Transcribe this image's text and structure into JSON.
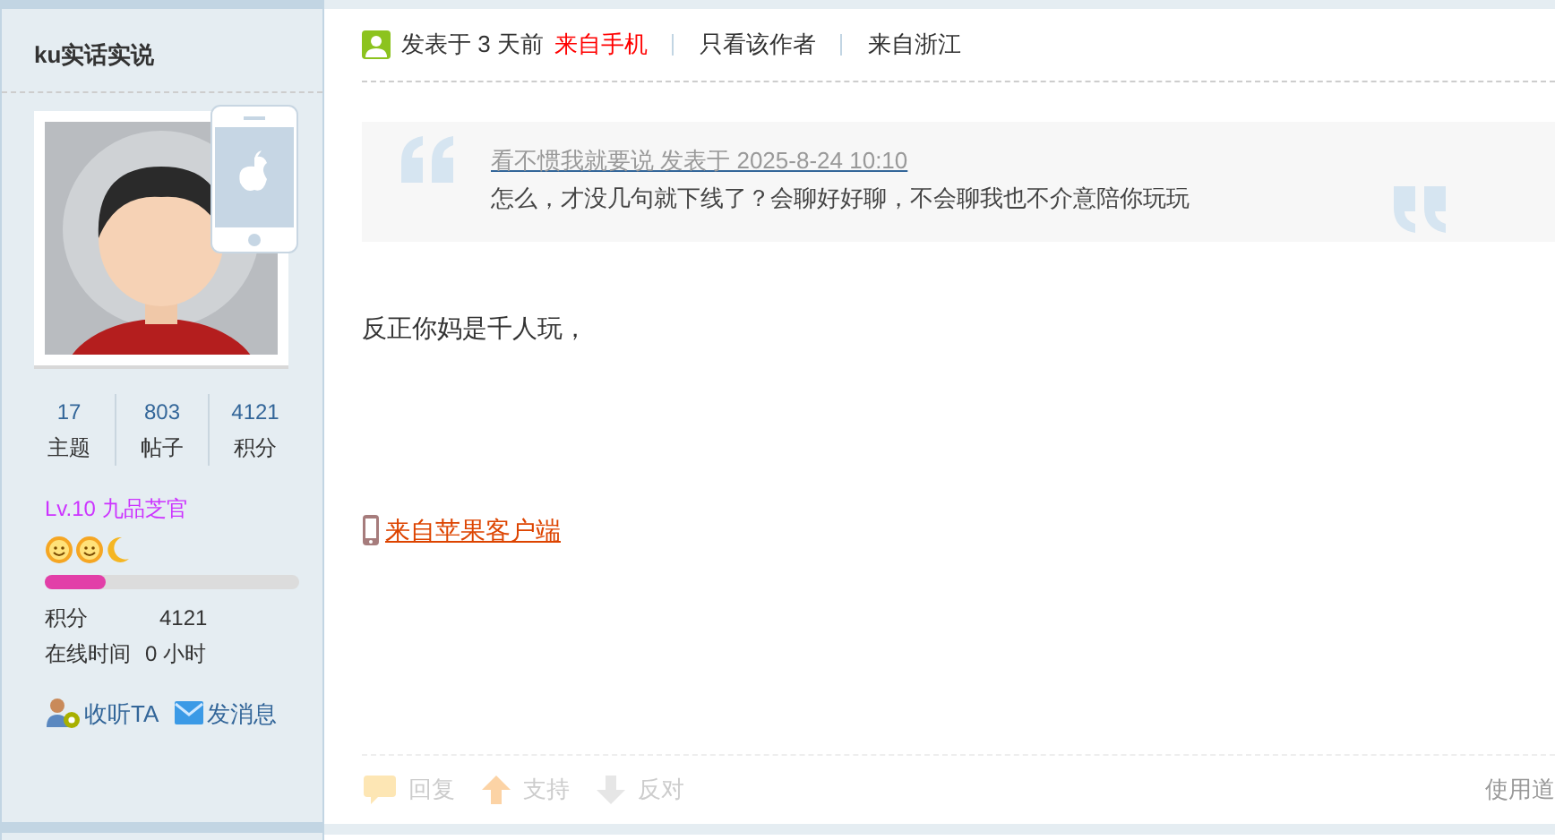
{
  "author": {
    "name": "ku实话实说",
    "stats": [
      {
        "value": "17",
        "label": "主题"
      },
      {
        "value": "803",
        "label": "帖子"
      },
      {
        "value": "4121",
        "label": "积分"
      }
    ],
    "rank": "Lv.10 九品芝官",
    "badges": [
      {
        "kind": "sun"
      },
      {
        "kind": "sun"
      },
      {
        "kind": "moon"
      }
    ],
    "level": 0.24,
    "info": [
      {
        "label": "积分",
        "value": "4121"
      },
      {
        "label": "在线时间",
        "value": "0 小时"
      }
    ],
    "actions": [
      {
        "kind": "follow",
        "label": "收听TA"
      },
      {
        "kind": "message",
        "label": "发消息"
      }
    ]
  },
  "post": {
    "meta": {
      "posted": "发表于 3 天前",
      "source": "来自手机",
      "links": [
        "只看该作者",
        "来自浙江"
      ]
    },
    "quote": {
      "header": "看不惯我就要说 发表于 2025-8-24 10:10",
      "text": "怎么，才没几句就下线了？会聊好好聊，不会聊我也不介意陪你玩玩"
    },
    "body": "反正你妈是千人玩，",
    "client_link": "来自苹果客户端",
    "actions": [
      {
        "kind": "reply",
        "label": "回复"
      },
      {
        "kind": "support",
        "label": "支持"
      },
      {
        "kind": "oppose",
        "label": "反对"
      }
    ],
    "tools_label": "使用道"
  }
}
